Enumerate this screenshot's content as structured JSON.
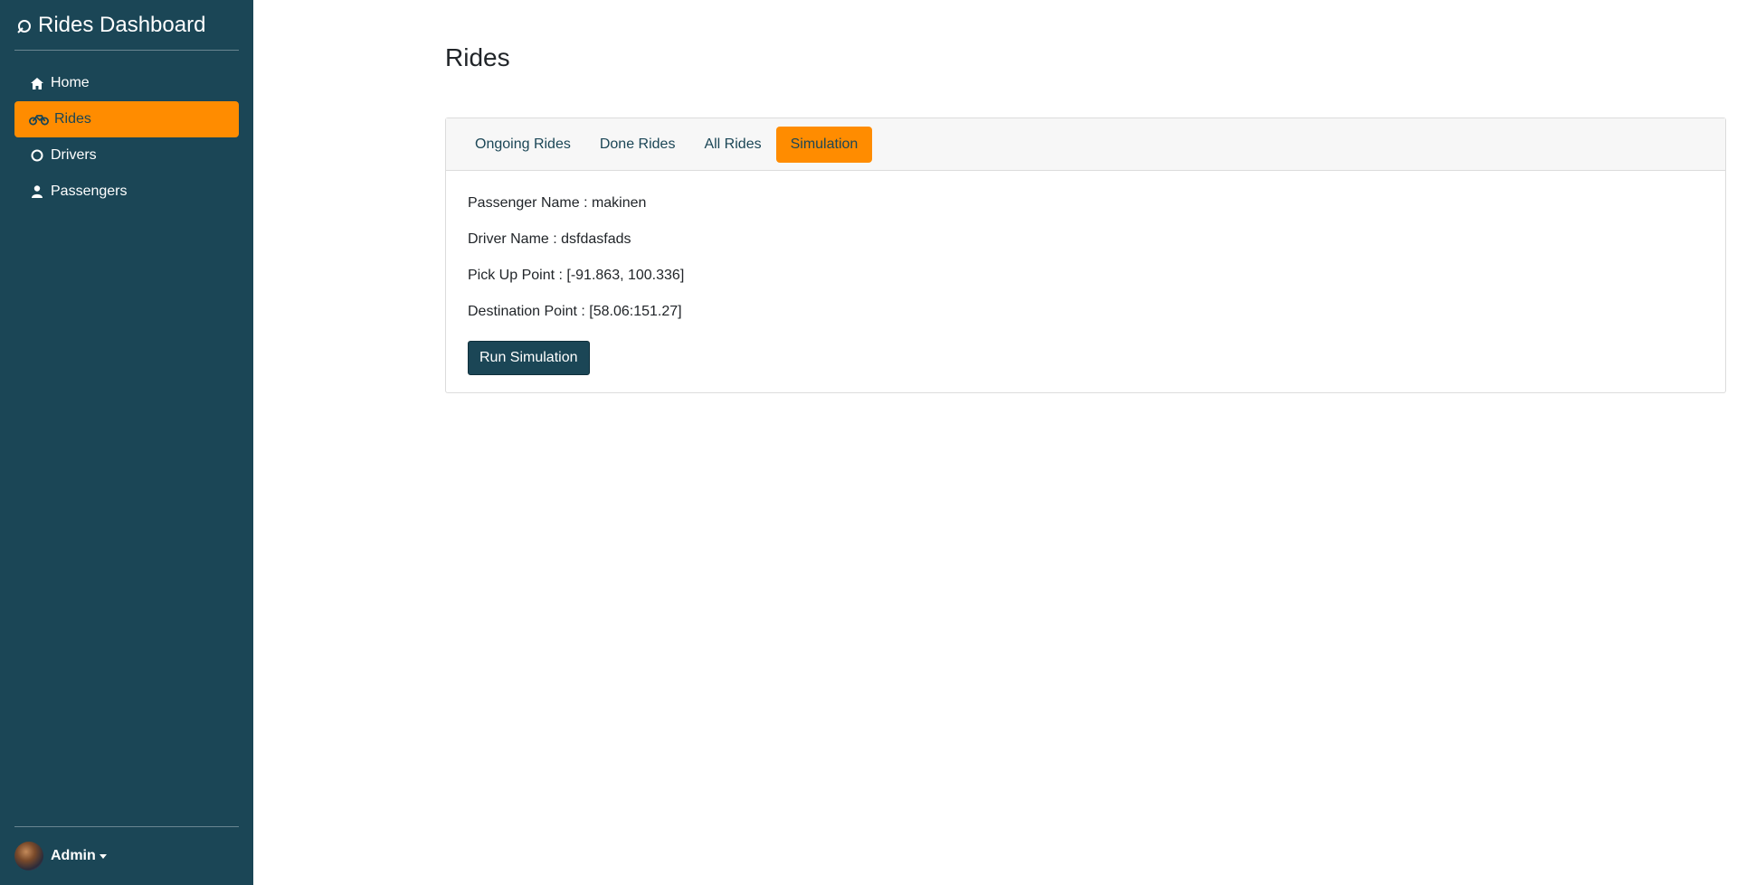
{
  "app": {
    "title": "Rides Dashboard"
  },
  "sidebar": {
    "items": [
      {
        "label": "Home",
        "icon": "home-icon"
      },
      {
        "label": "Rides",
        "icon": "motorcycle-icon",
        "active": true
      },
      {
        "label": "Drivers",
        "icon": "circle-icon"
      },
      {
        "label": "Passengers",
        "icon": "user-icon"
      }
    ],
    "user": {
      "name": "Admin"
    }
  },
  "page": {
    "title": "Rides"
  },
  "tabs": [
    {
      "label": "Ongoing Rides"
    },
    {
      "label": "Done Rides"
    },
    {
      "label": "All Rides"
    },
    {
      "label": "Simulation",
      "active": true
    }
  ],
  "simulation": {
    "passenger": "Passenger Name : makinen",
    "driver": "Driver Name : dsfdasfads",
    "pickup": "Pick Up Point : [-91.863, 100.336]",
    "destination": "Destination Point : [58.06:151.27]",
    "run_label": "Run Simulation"
  },
  "colors": {
    "sidebar": "#1b4656",
    "accent": "#ff8c00"
  }
}
